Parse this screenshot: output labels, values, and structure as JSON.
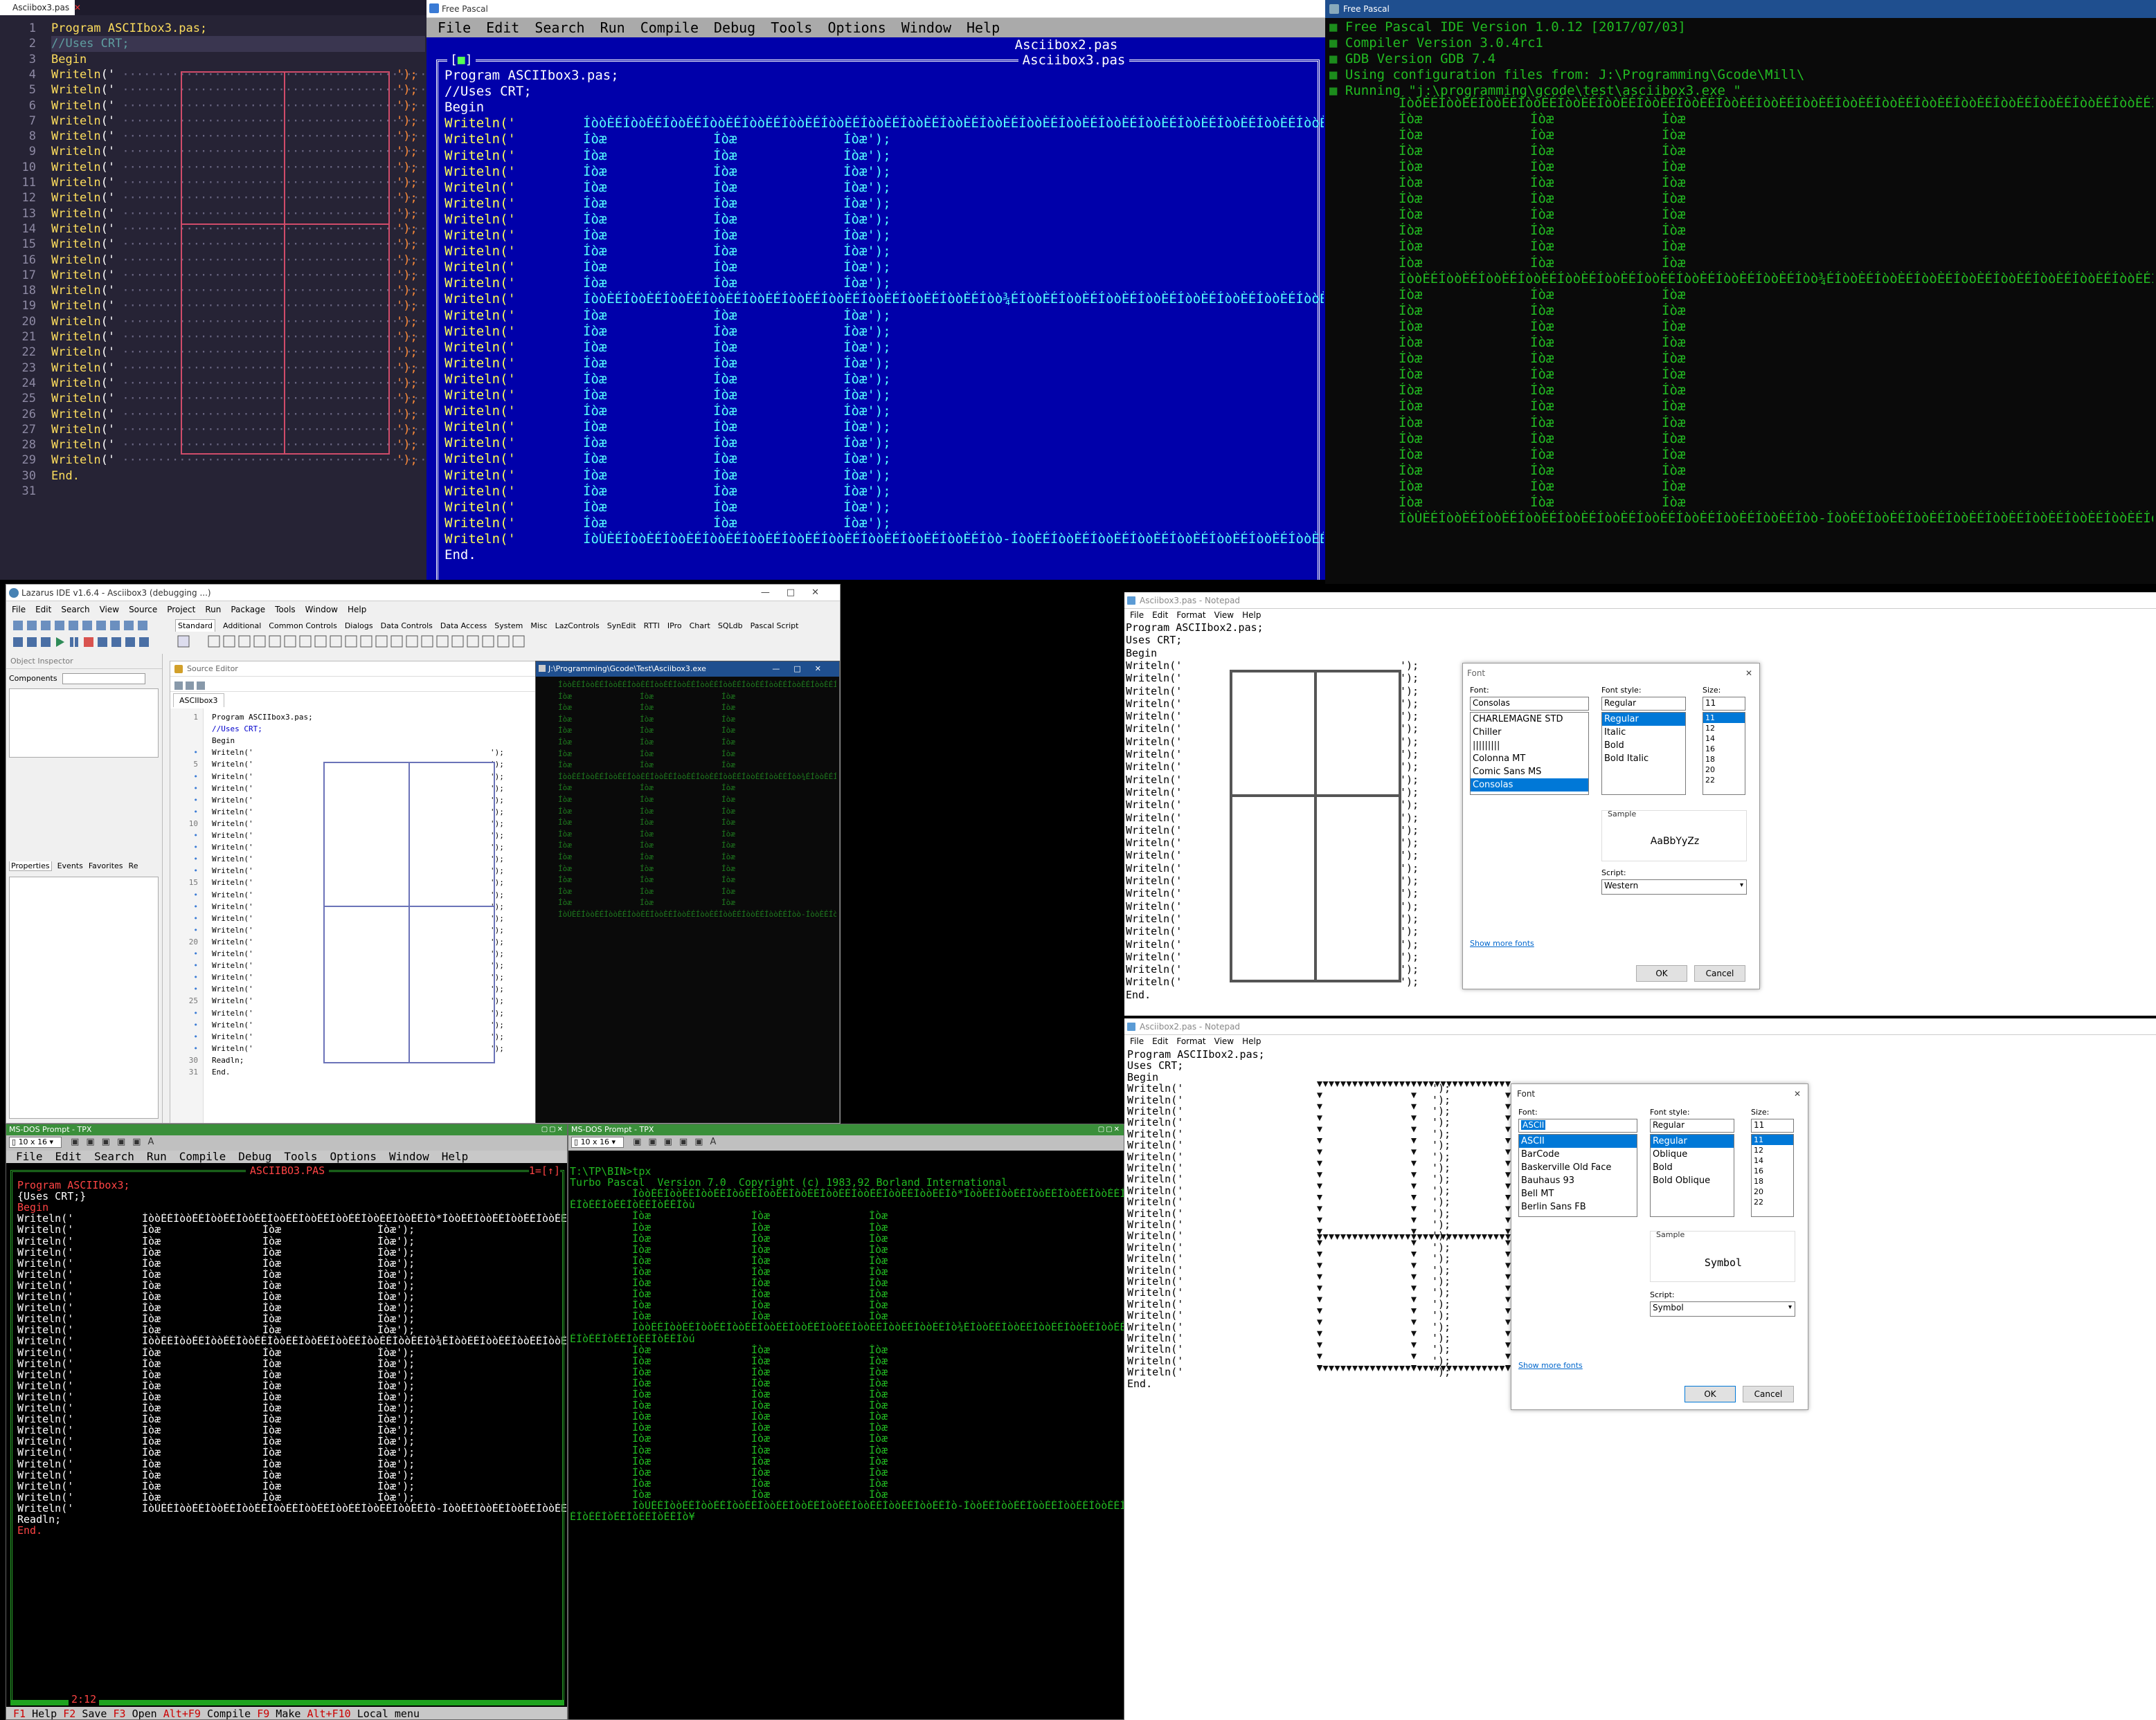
{
  "colors": {
    "vscode_bg": "#262335",
    "vscode_kw": "#fede5d",
    "vscode_str": "#ff8b39",
    "vscode_box": "#d04c6a",
    "fp_blue": "#0000aa",
    "fp_text": "#ffffff",
    "fp_yellow": "#ffff55",
    "fp_cyan": "#55ffff",
    "term_green": "#22bb22",
    "dos_red": "#ff4444",
    "dos_green_bar": "#1fa31f"
  },
  "vscode": {
    "tab": "Asciibox3.pas",
    "lines": [
      "Program ASCIIbox3.pas;",
      "//Uses CRT;",
      "Begin",
      "Writeln('",
      "End."
    ],
    "line_numbers": [
      "1",
      "2",
      "3",
      "4",
      "5",
      "6",
      "7",
      "8",
      "9",
      "10",
      "11",
      "12",
      "13",
      "14",
      "15",
      "16",
      "17",
      "18",
      "19",
      "20",
      "21",
      "22",
      "23",
      "24",
      "25",
      "26",
      "27",
      "28",
      "29",
      "30",
      "31"
    ]
  },
  "fpide": {
    "title": "Free Pascal",
    "menu": [
      "File",
      "Edit",
      "Search",
      "Run",
      "Compile",
      "Debug",
      "Tools",
      "Options",
      "Window",
      "Help"
    ],
    "top_frame_title": "Asciibox2.pas",
    "editor_title": "Asciibox3.pas",
    "lines": [
      "Program ASCIIbox3.pas;",
      "//Uses CRT;",
      "Begin",
      "End."
    ],
    "wr": "Writeln('",
    "box_top": "ÍòòÈÉÍòòÈÉÍòòÈÉÍòòÈÉÍòòÈÉÍòòÈÉÍòòÈÉÍòòÈÉÍòòÈÉÍòòÈÉÍòòÈÉÍòòÈÉÍòòÈÉÍòòÈÉÍòòÈÉÍòòÈÉÍòòÈÉÍòòÈÉÍòòÈÉÍòòÈÉÍòòÈÉÍòòÈÉÍòòÈÉÍòòÈÉÍòòÈÉÍòòÈÉÍòòÈÉÍòòÈÉÍòòÈÉÍòòÈÉÍòòÈÉÍòù');",
    "box_mid": "ÍòòÈÉÍòòÈÉÍòòÈÉÍòòÈÉÍòòÈÉÍòòÈÉÍòòÈÉÍòòÈÉÍòòÈÉÍòòÈÉÍòò¾ÉÍòòÈÉÍòòÈÉÍòòÈÉÍòòÈÉÍòòÈÉÍòòÈÉÍòòÈÉÍòòÈÉÍòòÈÉÍòòÈÉÍòòÈÉÍòòÈÉÍòòÈÉÍòòÈÉÍòòÈÉÍòòÈÉÍòòÈÉÍòú');",
    "box_bot": "ÍòÙÈÉÍòòÈÉÍòòÈÉÍòòÈÉÍòòÈÉÍòòÈÉÍòòÈÉÍòòÈÉÍòòÈÉÍòòÈÉÍòò-ÍòòÈÉÍòòÈÉÍòòÈÉÍòòÈÉÍòòÈÉÍòòÈÉÍòòÈÉÍòòÈÉÍòòÈÉÍòòÈÉÍòòÈÉÍòòÈÉÍòòÈÉÍòòÈÉÍòòÈÉÍòòÈÉÍòòÈÉÍòòÈÉÍò¥');",
    "cell": "Íòæ",
    "cell_end": "Íòæ');"
  },
  "fpterm": {
    "title": "Free Pascal",
    "lines": [
      "Free Pascal IDE Version 1.0.12 [2017/07/03]",
      "Compiler Version 3.0.4rc1",
      "GDB Version GDB 7.4",
      "Using configuration files from: J:\\Programming\\Gcode\\Mill\\",
      "Running \"j:\\programming\\gcode\\test\\asciibox3.exe \""
    ],
    "box_top": "ÍòòÈÉÍòòÈÉÍòòÈÉÍòòÈÉÍòòÈÉÍòòÈÉÍòòÈÉÍòòÈÉÍòòÈÉÍòòÈÉÍòòÈÉÍòòÈÉÍòòÈÉÍòòÈÉÍòòÈÉÍòòÈÉÍòòÈÉÍòòÈÉÍòòÈÉÍòòÈÉÍòòÈÉÍòòÈÉÍòòÈÉÍòòÈÉÍòòÈÉÍòòÈÉÍòòÈÉÍòòÈÉÍòòÈÉÍòòÈÉÍòòÈÉÍòù",
    "box_mid": "ÍòòÈÉÍòòÈÉÍòòÈÉÍòòÈÉÍòòÈÉÍòòÈÉÍòòÈÉÍòòÈÉÍòòÈÉÍòòÈÉÍòò¾ÉÍòòÈÉÍòòÈÉÍòòÈÉÍòòÈÉÍòòÈÉÍòòÈÉÍòòÈÉÍòòÈÉÍòòÈÉÍòòÈÉÍòòÈÉÍòòÈÉÍòòÈÉÍòòÈÉÍòòÈÉÍòòÈÉÍòòÈÉÍòú",
    "box_bot": "ÍòÙÈÉÍòòÈÉÍòòÈÉÍòòÈÉÍòòÈÉÍòòÈÉÍòòÈÉÍòòÈÉÍòòÈÉÍòòÈÉÍòò-ÍòòÈÉÍòòÈÉÍòòÈÉÍòòÈÉÍòòÈÉÍòòÈÉÍòòÈÉÍòòÈÉÍòòÈÉÍòòÈÉÍòòÈÉÍòòÈÉÍòòÈÉÍòòÈÉÍòòÈÉÍòòÈÉÍòòÈÉÍòòÈÉÍò¥",
    "cell": "Íòæ"
  },
  "lazarus": {
    "title": "Lazarus IDE v1.6.4 - Asciibox3 (debugging ...)",
    "menu": [
      "File",
      "Edit",
      "Search",
      "View",
      "Source",
      "Project",
      "Run",
      "Package",
      "Tools",
      "Window",
      "Help"
    ],
    "palette_tabs": [
      "Standard",
      "Additional",
      "Common Controls",
      "Dialogs",
      "Data Controls",
      "Data Access",
      "System",
      "Misc",
      "LazControls",
      "SynEdit",
      "RTTI",
      "IPro",
      "Chart",
      "SQLdb",
      "Pascal Script"
    ],
    "object_inspector": "Object Inspector",
    "components_label": "Components",
    "oi_tabs": [
      "Properties",
      "Events",
      "Favorites",
      "Re"
    ],
    "source_editor": "Source Editor",
    "source_tab": "ASCIIbox3",
    "lines": [
      "Program ASCIIbox3.pas;",
      "//Uses CRT;",
      "Begin",
      "Writeln('",
      "Readln;",
      "End."
    ],
    "line_numbers": [
      "1",
      "",
      "",
      "",
      "5",
      "",
      "",
      "",
      "",
      "10",
      "",
      "",
      "",
      "",
      "15",
      "",
      "",
      "",
      "",
      "20",
      "",
      "",
      "",
      "",
      "25",
      "",
      "",
      "",
      "",
      "30",
      "31"
    ],
    "console_title": "J:\\Programming\\Gcode\\Test\\Asciibox3.exe"
  },
  "notepad1": {
    "title": "Asciibox3.pas - Notepad",
    "menu": [
      "File",
      "Edit",
      "Format",
      "View",
      "Help"
    ],
    "lines": [
      "Program ASCIIbox2.pas;",
      "Uses CRT;",
      "Begin",
      "Writeln('",
      "End."
    ],
    "dialog": {
      "title": "Font",
      "font_label": "Font:",
      "font_value": "Consolas",
      "fonts": [
        "CHARLEMAGNE STD",
        "Chiller",
        "|||||||||",
        "Colonna MT",
        "Comic Sans MS",
        "Consolas"
      ],
      "style_label": "Font style:",
      "style_value": "Regular",
      "styles": [
        "Regular",
        "Italic",
        "Bold",
        "Bold Italic"
      ],
      "size_label": "Size:",
      "size_value": "11",
      "sizes": [
        "11",
        "12",
        "14",
        "16",
        "18",
        "20",
        "22"
      ],
      "sample_label": "Sample",
      "sample_text": "AaBbYyZz",
      "script_label": "Script:",
      "script_value": "Western",
      "show_more": "Show more fonts",
      "ok": "OK",
      "cancel": "Cancel"
    }
  },
  "notepad2": {
    "title": "Asciibox2.pas - Notepad",
    "menu": [
      "File",
      "Edit",
      "Format",
      "View",
      "Help"
    ],
    "lines": [
      "Program ASCIIbox2.pas;",
      "Uses CRT;",
      "Begin",
      "Writeln('",
      "End."
    ],
    "dialog": {
      "title": "Font",
      "font_label": "Font:",
      "font_value": "ASCII",
      "fonts": [
        "ASCII",
        "BarCode",
        "Baskerville Old Face",
        "Bauhaus 93",
        "Bell MT",
        "Berlin Sans FB"
      ],
      "style_label": "Font style:",
      "style_value": "Regular",
      "styles": [
        "Regular",
        "Oblique",
        "Bold",
        "Bold Oblique"
      ],
      "size_label": "Size:",
      "size_value": "11",
      "sizes": [
        "11",
        "12",
        "14",
        "16",
        "18",
        "20",
        "22"
      ],
      "sample_label": "Sample",
      "sample_text": "Symbol",
      "script_label": "Script:",
      "script_value": "Symbol",
      "show_more": "Show more fonts",
      "ok": "OK",
      "cancel": "Cancel"
    }
  },
  "dos1": {
    "title": "MS-DOS Prompt - TPX",
    "font_select": "10 x 16",
    "menu": [
      "File",
      "Edit",
      "Search",
      "Run",
      "Compile",
      "Debug",
      "Tools",
      "Options",
      "Window",
      "Help"
    ],
    "editor_title": "ASCIIBO3.PAS",
    "window_num": "1=[↑]",
    "lines": [
      "Program ASCIIbox3;",
      "{Uses CRT;}",
      "Begin",
      "Writeln('",
      "Readln;",
      "End."
    ],
    "cursor_pos": "2:12",
    "status": [
      {
        "key": "F1",
        "label": "Help"
      },
      {
        "key": "F2",
        "label": "Save"
      },
      {
        "key": "F3",
        "label": "Open"
      },
      {
        "key": "Alt+F9",
        "label": "Compile"
      },
      {
        "key": "F9",
        "label": "Make"
      },
      {
        "key": "Alt+F10",
        "label": "Local menu"
      }
    ],
    "box_top": "ÍòòÈÉÍòòÈÉÍòòÈÉÍòòÈÉÍòòÈÉÍòòÈÉÍòòÈÉÍòòÈÉÍòòÈÉÍò*ÍòòÈÉÍòòÈÉÍòòÈÉÍòòÈÉÍòòÈÉÍòòÈÉÍòòÈÉÍòòÈ",
    "box_mid": "ÍòòÈÉÍòòÈÉÍòòÈÉÍòòÈÉÍòòÈÉÍòòÈÉÍòòÈÉÍòòÈÉÍòòÈÉÍò¾ÉÍòòÈÉÍòòÈÉÍòòÈÉÍòòÈÉÍòòÈÉÍòòÈÉÍòòÈÉÍò",
    "box_bot": "ÍòÙÈÉÍòòÈÉÍòòÈÉÍòòÈÉÍòòÈÉÍòòÈÉÍòòÈÉÍòòÈÉÍòòÈÉÍò-ÍòòÈÉÍòòÈÉÍòòÈÉÍòòÈÉÍòòÈÉÍòòÈÉÍòòÈÉÍòò",
    "cell": "Íòæ",
    "cell_end": "Íòæ');"
  },
  "dos2": {
    "title": "MS-DOS Prompt - TPX",
    "font_select": "10 x 16",
    "prompt": "T:\\TP\\BIN>tpx",
    "banner": "Turbo Pascal  Version 7.0  Copyright (c) 1983,92 Borland International",
    "box_top": "ÍòòÈÉÍòòÈÉÍòòÈÉÍòòÈÉÍòòÈÉÍòòÈÉÍòòÈÉÍòòÈÉÍòòÈÉÍòòÈÉÍò*ÍòòÈÉÍòòÈÉÍòòÈÉÍòòÈÉÍòòÈÉÍòòÈÉÍòòÈÉÍòòÈÉ",
    "box_top2": "ÉÍòÈÉÍòÈÉÍòÈÉÍòÈÉÍòù",
    "box_mid": "ÍòòÈÉÍòòÈÉÍòòÈÉÍòòÈÉÍòòÈÉÍòòÈÉÍòòÈÉÍòòÈÉÍòòÈÉÍòòÈÉÍò¾ÉÍòòÈÉÍòòÈÉÍòòÈÉÍòòÈÉÍòòÈÉÍòòÈÉÍòòÈÉÍòòÈ",
    "box_mid2": "ÉÍòÈÉÍòÈÉÍòÈÉÍòÈÉÍòú",
    "box_bot": "ÍòÙÈÉÍòòÈÉÍòòÈÉÍòòÈÉÍòòÈÉÍòòÈÉÍòòÈÉÍòòÈÉÍòòÈÉÍòòÈÉÍò-ÍòòÈÉÍòòÈÉÍòòÈÉÍòòÈÉÍòòÈÉÍòòÈÉÍòòÈÉÍòòÈ",
    "box_bot2": "ÉÍòÈÉÍòÈÉÍòÈÉÍòÈÉÍò¥",
    "cell": "Íòæ"
  }
}
